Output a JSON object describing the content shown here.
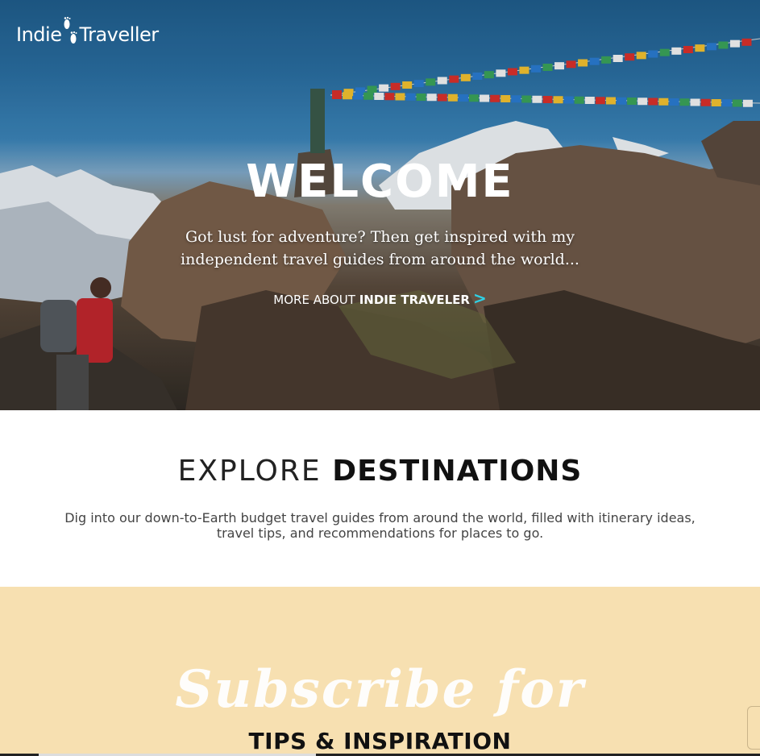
{
  "brand": {
    "name_left": "Indie",
    "name_right": "Traveller"
  },
  "hero": {
    "title": "WELCOME",
    "intro_line1": "Got lust for adventure? Then get inspired with my",
    "intro_line2": "independent travel guides from around the world...",
    "more_prefix": "MORE ABOUT ",
    "more_bold": "INDIE TRAVELER",
    "more_chevron": ">",
    "accent_color": "#2fd0e4"
  },
  "explore": {
    "title_light": "EXPLORE",
    "title_bold": "DESTINATIONS",
    "description": "Dig into our down-to-Earth budget travel guides from around the world, filled with itinerary ideas, travel tips, and recommendations for places to go."
  },
  "subscribe": {
    "script_text": "Subscribe for",
    "headline": "TIPS & INSPIRATION",
    "background_color": "#f7e0b1"
  },
  "icons": {
    "logo_mark": "footprints-icon",
    "more_chevron": "chevron-right-icon"
  }
}
